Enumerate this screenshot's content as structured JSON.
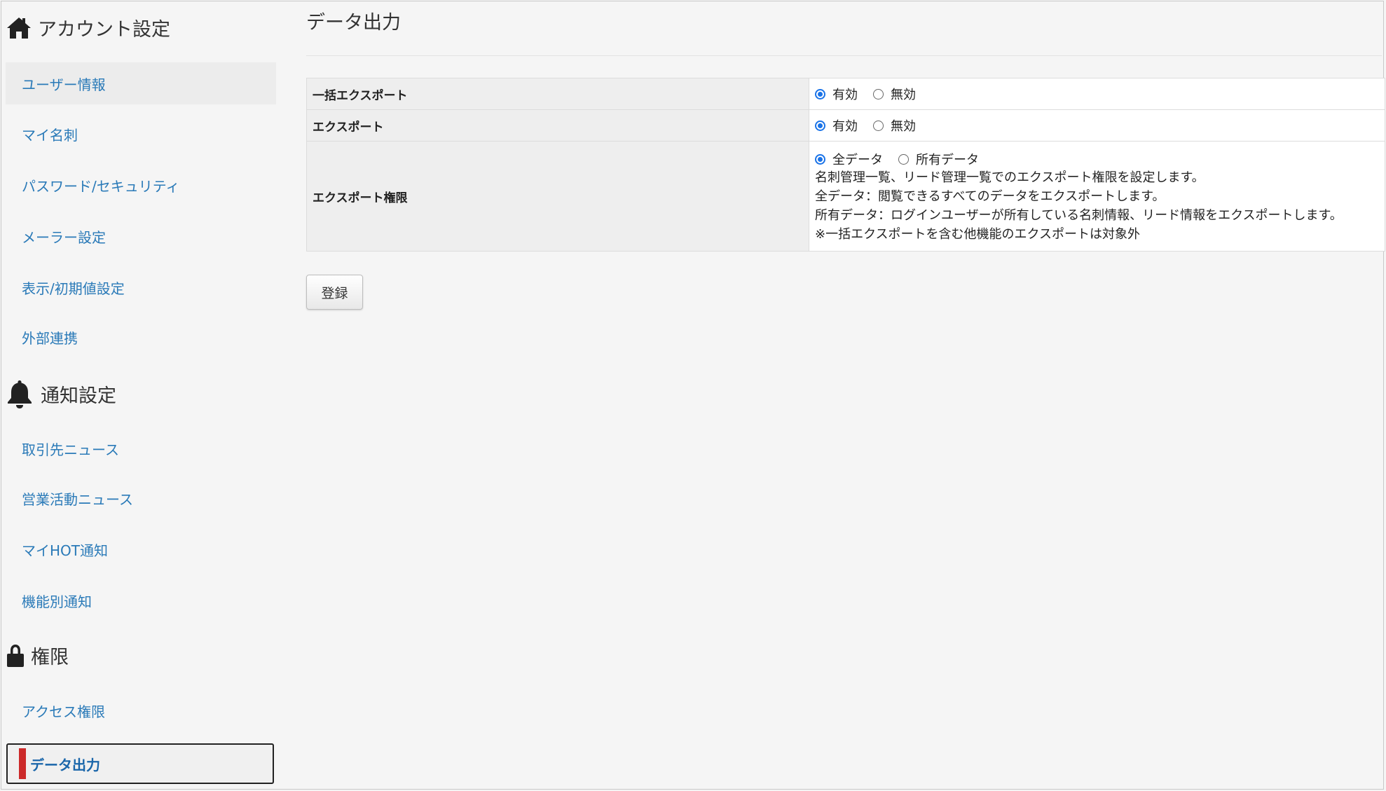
{
  "sidebar": {
    "sections": [
      {
        "title": "アカウント設定",
        "icon": "home-icon",
        "items": [
          {
            "label": "ユーザー情報"
          },
          {
            "label": "マイ名刺"
          },
          {
            "label": "パスワード/セキュリティ"
          },
          {
            "label": "メーラー設定"
          },
          {
            "label": "表示/初期値設定"
          },
          {
            "label": "外部連携"
          }
        ]
      },
      {
        "title": "通知設定",
        "icon": "bell-icon",
        "items": [
          {
            "label": "取引先ニュース"
          },
          {
            "label": "営業活動ニュース"
          },
          {
            "label": "マイHOT通知"
          },
          {
            "label": "機能別通知"
          }
        ]
      },
      {
        "title": "権限",
        "icon": "lock-icon",
        "items": [
          {
            "label": "アクセス権限"
          },
          {
            "label": "データ出力"
          }
        ]
      }
    ]
  },
  "main": {
    "title": "データ出力",
    "rows": [
      {
        "label": "一括エクスポート",
        "options": [
          {
            "label": "有効",
            "checked": true
          },
          {
            "label": "無効",
            "checked": false
          }
        ]
      },
      {
        "label": "エクスポート",
        "options": [
          {
            "label": "有効",
            "checked": true
          },
          {
            "label": "無効",
            "checked": false
          }
        ]
      },
      {
        "label": "エクスポート権限",
        "options": [
          {
            "label": "全データ",
            "checked": true
          },
          {
            "label": "所有データ",
            "checked": false
          }
        ],
        "description": [
          "名刺管理一覧、リード管理一覧でのエクスポート権限を設定します。",
          "全データ：閲覧できるすべてのデータをエクスポートします。",
          "所有データ：ログインユーザーが所有している名刺情報、リード情報をエクスポートします。",
          "※一括エクスポートを含む他機能のエクスポートは対象外"
        ]
      }
    ],
    "register_label": "登録"
  },
  "colors": {
    "link": "#2a7ab8",
    "active_marker": "#cc2a2a",
    "radio_on": "#1a73e8"
  }
}
